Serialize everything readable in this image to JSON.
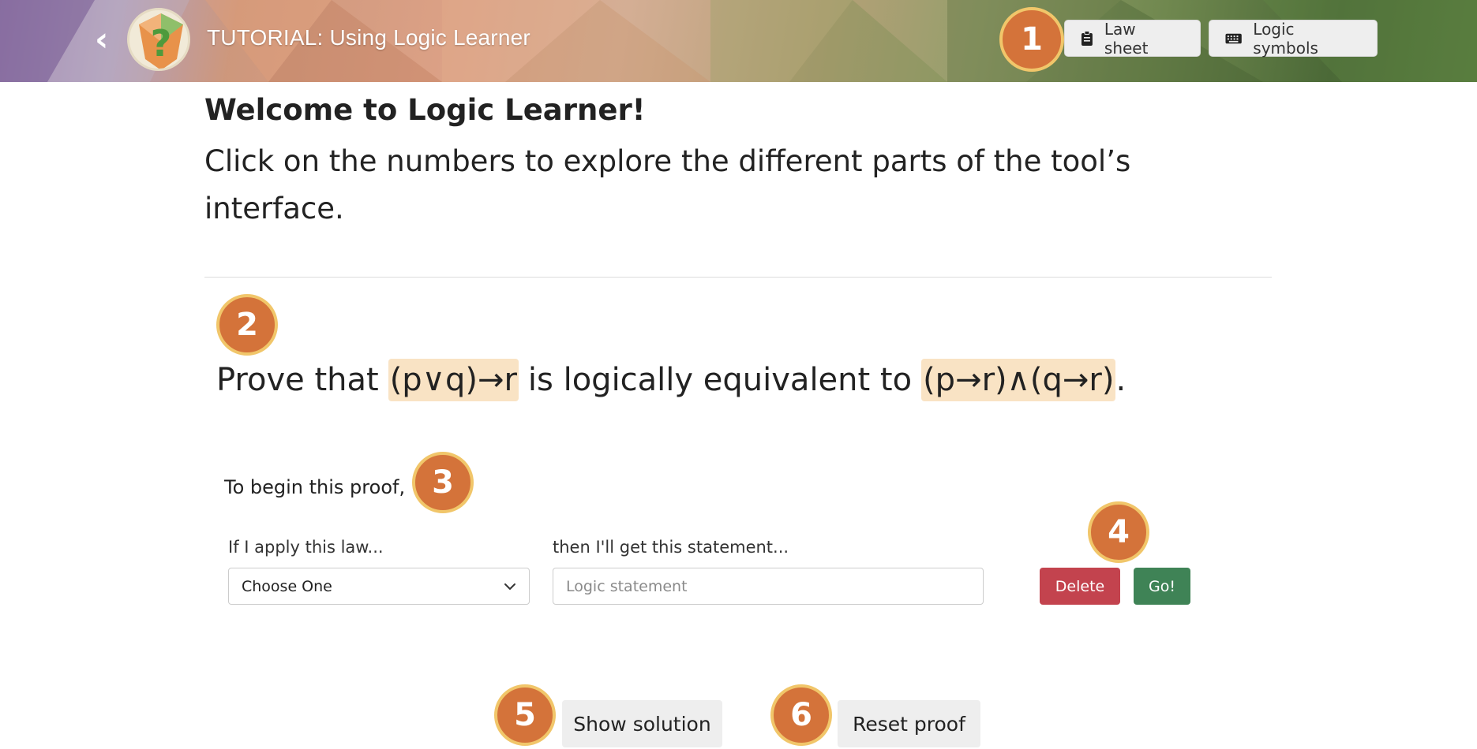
{
  "header": {
    "title": "TUTORIAL: Using Logic Learner",
    "law_sheet_label": "Law sheet",
    "logic_symbols_label": "Logic symbols",
    "logo_glyph": "?"
  },
  "badges": {
    "b1": "1",
    "b2": "2",
    "b3": "3",
    "b4": "4",
    "b5": "5",
    "b6": "6"
  },
  "intro": {
    "title": "Welcome to Logic Learner!",
    "text": "Click on the numbers to explore the different parts of the tool’s interface."
  },
  "problem": {
    "prefix": "Prove that",
    "formula_a": "(p∨q)→r",
    "middle": "is logically equivalent to",
    "formula_b": "(p→r)∧(q→r)",
    "suffix": "."
  },
  "proof": {
    "begin_text": "To begin this proof,",
    "law_label": "If I apply this law...",
    "statement_label": "then I'll get this statement...",
    "law_select_value": "Choose One",
    "statement_placeholder": "Logic statement",
    "delete_label": "Delete",
    "go_label": "Go!"
  },
  "footer": {
    "show_solution_label": "Show solution",
    "reset_proof_label": "Reset proof"
  },
  "colors": {
    "badge_fill": "#d4733a",
    "badge_ring": "#f1c66a",
    "formula_highlight": "#f9e3c4",
    "delete_red": "#c3434e",
    "go_green": "#3f8356"
  },
  "icons": {
    "back": "chevron-left-icon",
    "law_sheet": "clipboard-icon",
    "logic_symbols": "keyboard-icon",
    "select": "chevron-down-icon"
  }
}
